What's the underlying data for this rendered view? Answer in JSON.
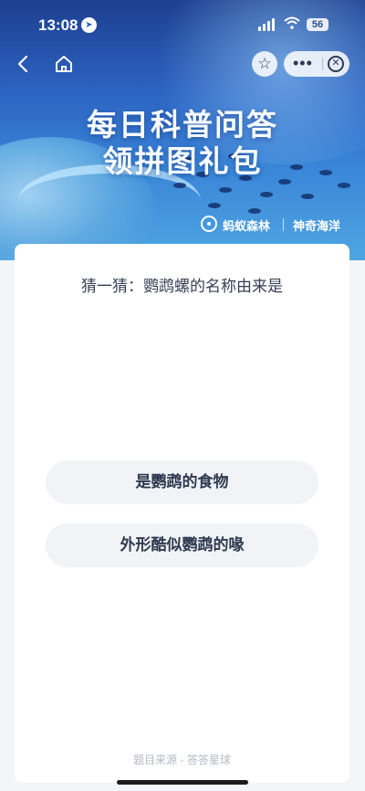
{
  "status_bar": {
    "time": "13:08",
    "battery": "56",
    "icons": [
      "location-arrow-icon",
      "signal-icon",
      "wifi-icon",
      "battery-icon"
    ]
  },
  "nav": {
    "icons": [
      "back-icon",
      "home-icon",
      "star-icon",
      "more-icon",
      "close-icon"
    ]
  },
  "banner": {
    "title_line1": "每日科普问答",
    "title_line2": "领拼图礼包",
    "brand1": "蚂蚁森林",
    "brand2": "神奇海洋"
  },
  "quiz": {
    "question": "猜一猜：鹦鹉螺的名称由来是",
    "options": [
      "是鹦鹉的食物",
      "外形酷似鹦鹉的喙"
    ],
    "source": "题目来源 - 答答星球"
  },
  "colors": {
    "banner_top": "#1d3f8f",
    "banner_bottom": "#4fa6e2",
    "option_bg": "#f1f3f6",
    "page_bg": "#f4f5f8"
  }
}
